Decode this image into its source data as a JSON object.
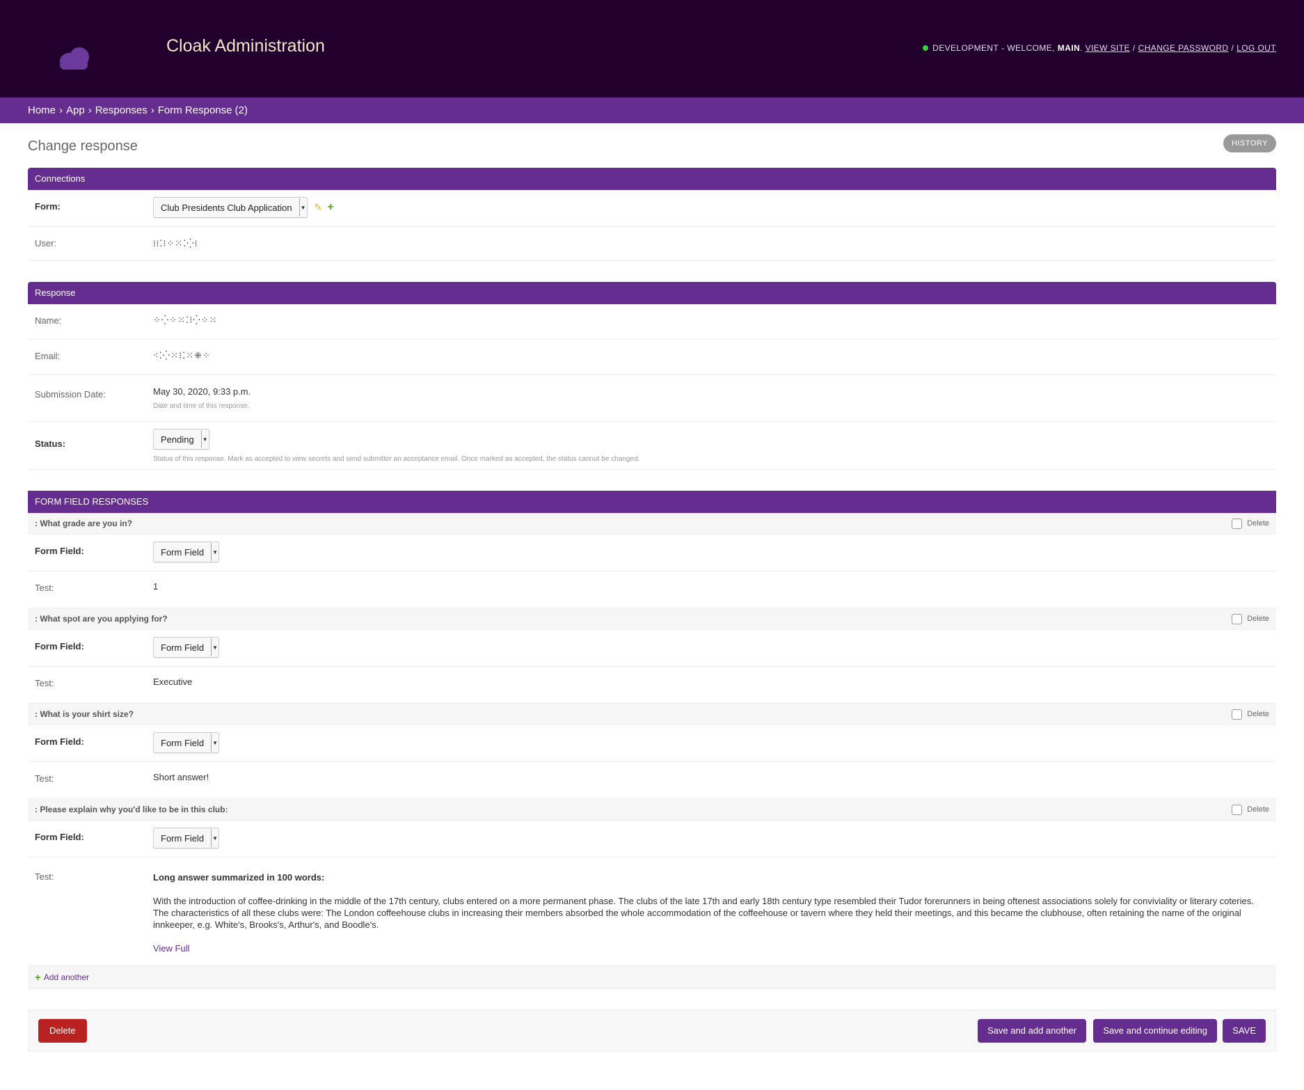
{
  "header": {
    "site_title": "Cloak Administration",
    "env": "DEVELOPMENT",
    "welcome": "- WELCOME,",
    "user": "MAIN",
    "links": [
      "VIEW SITE",
      "CHANGE PASSWORD",
      "LOG OUT"
    ]
  },
  "breadcrumbs": [
    "Home",
    "App",
    "Responses",
    "Form Response (2)"
  ],
  "page": {
    "title": "Change response",
    "history": "HISTORY"
  },
  "connections": {
    "heading": "Connections",
    "form_label": "Form:",
    "form_value": "Club Presidents Club Application",
    "user_label": "User:",
    "user_value": "⁞⁞⁚⁝⁘⁙⁚⁛⁞"
  },
  "response": {
    "heading": "Response",
    "name_label": "Name:",
    "name_value": "⁘⁛⁘⁙⁚⁝⁛⁘⁙",
    "email_label": "Email:",
    "email_value": "⁖⁚⁛⁙⁝⁚⁙⁜⁘",
    "date_label": "Submission Date:",
    "date_value": "May 30, 2020, 9:33 p.m.",
    "date_help": "Date and time of this response.",
    "status_label": "Status:",
    "status_value": "Pending",
    "status_help": "Status of this response. Mark as accepted to view secrets and send submitter an acceptance email. Once marked as accepted, the status cannot be changed."
  },
  "field_responses": {
    "heading": "FORM FIELD RESPONSES",
    "delete_label": "Delete",
    "form_field_label": "Form Field:",
    "form_field_value": "Form Field",
    "test_label": "Test:",
    "items": [
      {
        "question": ": What grade are you in?",
        "answer": "1"
      },
      {
        "question": ": What spot are you applying for?",
        "answer": "Executive"
      },
      {
        "question": ": What is your shirt size?",
        "answer": "Short answer!"
      },
      {
        "question": ": Please explain why you'd like to be in this club:",
        "answer_heading": "Long answer summarized in 100 words:",
        "answer": "With the introduction of coffee-drinking in the middle of the 17th century, clubs entered on a more permanent phase. The clubs of the late 17th and early 18th century type resembled their Tudor forerunners in being oftenest associations solely for conviviality or literary coteries. The characteristics of all these clubs were: The London coffeehouse clubs in increasing their members absorbed the whole accommodation of the coffeehouse or tavern where they held their meetings, and this became the clubhouse, often retaining the name of the original innkeeper, e.g. White's, Brooks's, Arthur's, and Boodle's.",
        "link": "View Full"
      }
    ],
    "add_another": "Add another"
  },
  "submit": {
    "delete": "Delete",
    "save_add": "Save and add another",
    "save_continue": "Save and continue editing",
    "save": "SAVE"
  }
}
